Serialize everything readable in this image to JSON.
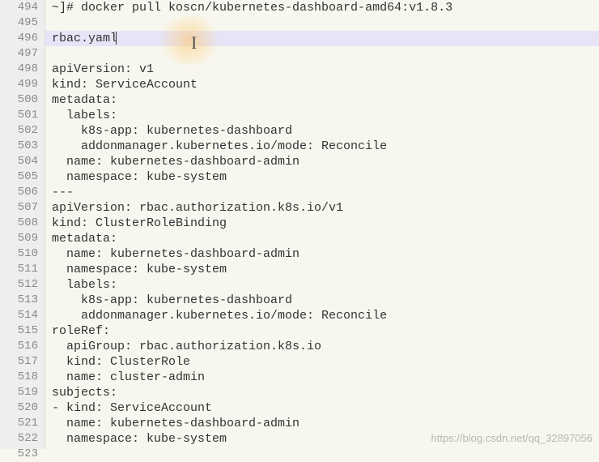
{
  "lineStart": 494,
  "lines": [
    "~]# docker pull koscn/kubernetes-dashboard-amd64:v1.8.3",
    "",
    "rbac.yaml",
    "",
    "apiVersion: v1",
    "kind: ServiceAccount",
    "metadata:",
    "  labels:",
    "    k8s-app: kubernetes-dashboard",
    "    addonmanager.kubernetes.io/mode: Reconcile",
    "  name: kubernetes-dashboard-admin",
    "  namespace: kube-system",
    "---",
    "apiVersion: rbac.authorization.k8s.io/v1",
    "kind: ClusterRoleBinding",
    "metadata:",
    "  name: kubernetes-dashboard-admin",
    "  namespace: kube-system",
    "  labels:",
    "    k8s-app: kubernetes-dashboard",
    "    addonmanager.kubernetes.io/mode: Reconcile",
    "roleRef:",
    "  apiGroup: rbac.authorization.k8s.io",
    "  kind: ClusterRole",
    "  name: cluster-admin",
    "subjects:",
    "- kind: ServiceAccount",
    "  name: kubernetes-dashboard-admin",
    "  namespace: kube-system",
    ""
  ],
  "highlightedLineIndex": 2,
  "watermark": "https://blog.csdn.net/qq_32897056"
}
